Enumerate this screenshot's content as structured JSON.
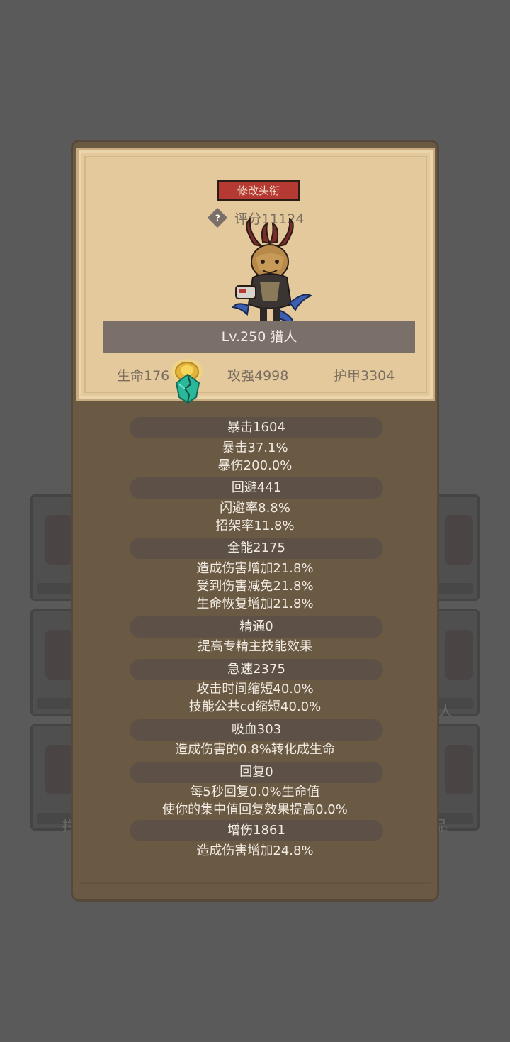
{
  "colors": {
    "background": "#5a5a5a",
    "popup": "#6b5a43",
    "parchment": "#e3c99c",
    "rename_button": "#b43a33",
    "level_bar": "#7a7069",
    "stat_header": "#5d5147",
    "text_light": "#f1ebe3",
    "text_dark": "#7b6e60"
  },
  "background": {
    "left_bottom_char": "拦",
    "right_middle_char": "人",
    "right_bottom_char": "品"
  },
  "hero": {
    "rename_label": "修改头衔",
    "help_icon": "help-icon",
    "score": "评分11124",
    "level_name": "Lv.250 猎人",
    "stats": {
      "hp": "生命176",
      "attack": "攻强4998",
      "armor": "护甲3304"
    }
  },
  "stats_list": [
    {
      "header": "暴击1604",
      "lines": [
        "暴击37.1%",
        "暴伤200.0%"
      ]
    },
    {
      "header": "回避441",
      "lines": [
        "闪避率8.8%",
        "招架率11.8%"
      ]
    },
    {
      "header": "全能2175",
      "lines": [
        "造成伤害增加21.8%",
        "受到伤害减免21.8%",
        "生命恢复增加21.8%"
      ]
    },
    {
      "header": "精通0",
      "lines": [
        "提高专精主技能效果"
      ]
    },
    {
      "header": "急速2375",
      "lines": [
        "攻击时间缩短40.0%",
        "技能公共cd缩短40.0%"
      ]
    },
    {
      "header": "吸血303",
      "lines": [
        "造成伤害的0.8%转化成生命"
      ]
    },
    {
      "header": "回复0",
      "lines": [
        "每5秒回复0.0%生命值",
        "使你的集中值回复效果提高0.0%"
      ]
    },
    {
      "header": "增伤1861",
      "lines": [
        "造成伤害增加24.8%"
      ]
    }
  ]
}
